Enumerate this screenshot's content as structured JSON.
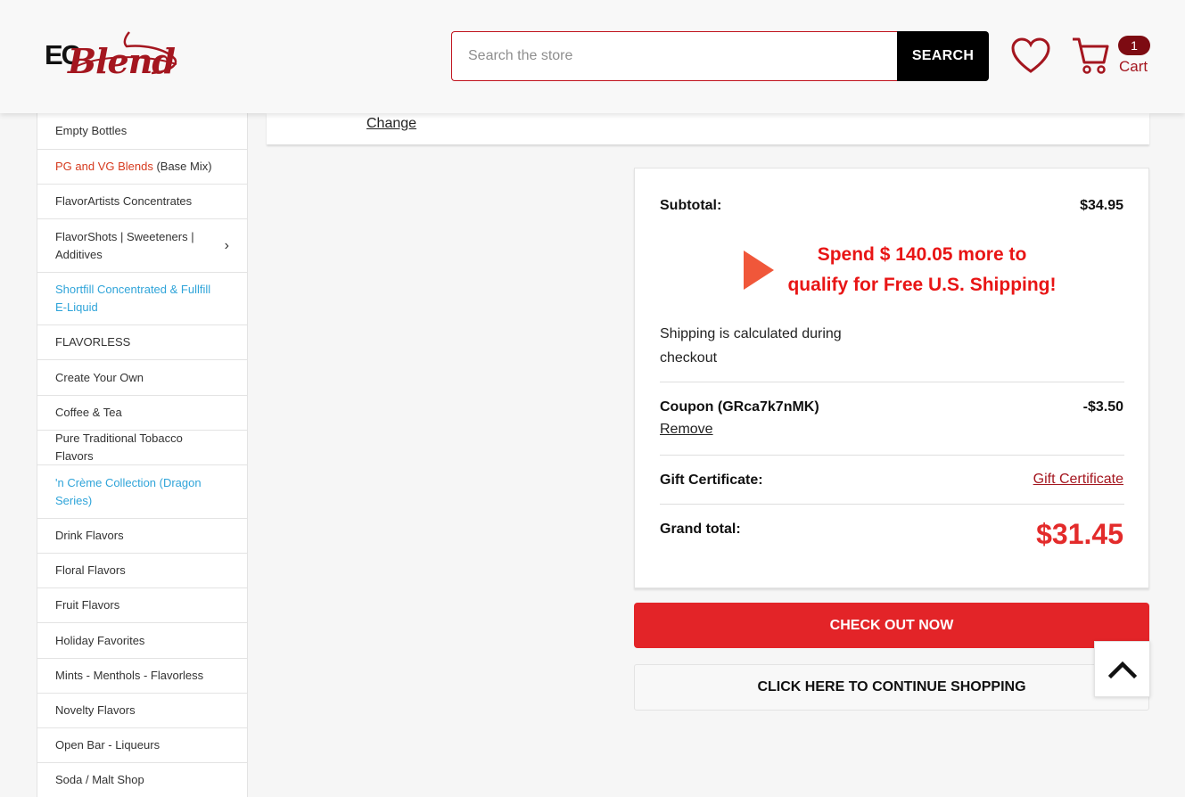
{
  "header": {
    "logo_ec": "EC",
    "logo_blend": "Blend",
    "search_placeholder": "Search the store",
    "search_button": "SEARCH",
    "cart_count": "1",
    "cart_label": "Cart"
  },
  "colors": {
    "brand_red": "#a4161f",
    "accent_red": "#e32428",
    "link_blue": "#2fa4d9",
    "highlight_orange": "#d63a1e"
  },
  "sidebar": {
    "items": [
      {
        "label": "Empty Bottles"
      },
      {
        "label_highlight": "PG and VG Blends",
        "label": " (Base Mix)"
      },
      {
        "label": "FlavorArtists Concentrates"
      },
      {
        "label": "FlavorShots | Sweeteners | Additives",
        "chevron": "›"
      },
      {
        "label": "Shortfill Concentrated & Fullfill E-Liquid"
      },
      {
        "label": "FLAVORLESS"
      },
      {
        "label": "Create Your Own"
      },
      {
        "label": "Coffee & Tea"
      },
      {
        "label": "Pure Traditional Tobacco Flavors"
      },
      {
        "label": "'n Crème Collection (Dragon Series)"
      },
      {
        "label": "Drink Flavors"
      },
      {
        "label": "Floral Flavors"
      },
      {
        "label": "Fruit Flavors"
      },
      {
        "label": "Holiday Favorites"
      },
      {
        "label": "Mints - Menthols - Flavorless"
      },
      {
        "label": "Novelty Flavors"
      },
      {
        "label": "Open Bar - Liqueurs"
      },
      {
        "label": "Soda / Malt Shop"
      }
    ]
  },
  "shipping_card": {
    "change_link": "Change"
  },
  "summary": {
    "subtotal_label": "Subtotal:",
    "subtotal_value": "$34.95",
    "promo_line1": "Spend $ 140.05 more to",
    "promo_line2": "qualify for Free U.S. Shipping!",
    "shipping_note": "Shipping is calculated during checkout",
    "coupon_label": "Coupon (GRca7k7nMK)",
    "coupon_value": "-$3.50",
    "remove_link": "Remove",
    "gift_label": "Gift Certificate:",
    "gift_link": "Gift Certificate",
    "grand_label": "Grand total:",
    "grand_value": "$31.45"
  },
  "actions": {
    "checkout": "CHECK OUT NOW",
    "continue": "CLICK HERE TO CONTINUE SHOPPING"
  }
}
